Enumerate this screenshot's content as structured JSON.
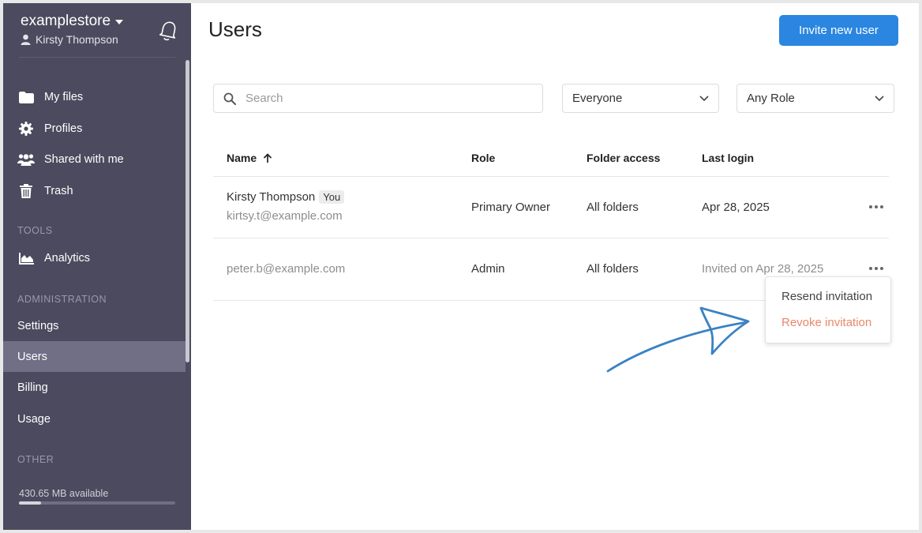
{
  "sidebar": {
    "store_name": "examplestore",
    "user_name": "Kirsty Thompson",
    "items": [
      {
        "label": "My files"
      },
      {
        "label": "Profiles"
      },
      {
        "label": "Shared with me"
      },
      {
        "label": "Trash"
      }
    ],
    "tools_heading": "TOOLS",
    "tools_items": [
      {
        "label": "Analytics"
      }
    ],
    "admin_heading": "ADMINISTRATION",
    "admin_items": [
      {
        "label": "Settings"
      },
      {
        "label": "Users"
      },
      {
        "label": "Billing"
      },
      {
        "label": "Usage"
      }
    ],
    "other_heading": "OTHER",
    "storage_text": "430.65 MB available",
    "storage_used_fraction": 0.14
  },
  "header": {
    "title": "Users",
    "invite_label": "Invite new user"
  },
  "filters": {
    "search_placeholder": "Search",
    "audience_value": "Everyone",
    "role_value": "Any Role"
  },
  "table": {
    "columns": {
      "name": "Name",
      "role": "Role",
      "folder_access": "Folder access",
      "last_login": "Last login"
    },
    "rows": [
      {
        "name": "Kirsty Thompson",
        "badge": "You",
        "email": "kirtsy.t@example.com",
        "role": "Primary Owner",
        "folder_access": "All folders",
        "last_login": "Apr 28, 2025"
      },
      {
        "email": "peter.b@example.com",
        "role": "Admin",
        "folder_access": "All folders",
        "last_login": "Invited on Apr 28, 2025"
      }
    ]
  },
  "row_menu": {
    "resend": "Resend invitation",
    "revoke": "Revoke invitation"
  },
  "colors": {
    "sidebar_bg": "#4b4a5e",
    "sidebar_active": "#706f86",
    "primary": "#2a86e0",
    "danger_text": "#e8876a",
    "annotation_arrow": "#3a82c4"
  }
}
